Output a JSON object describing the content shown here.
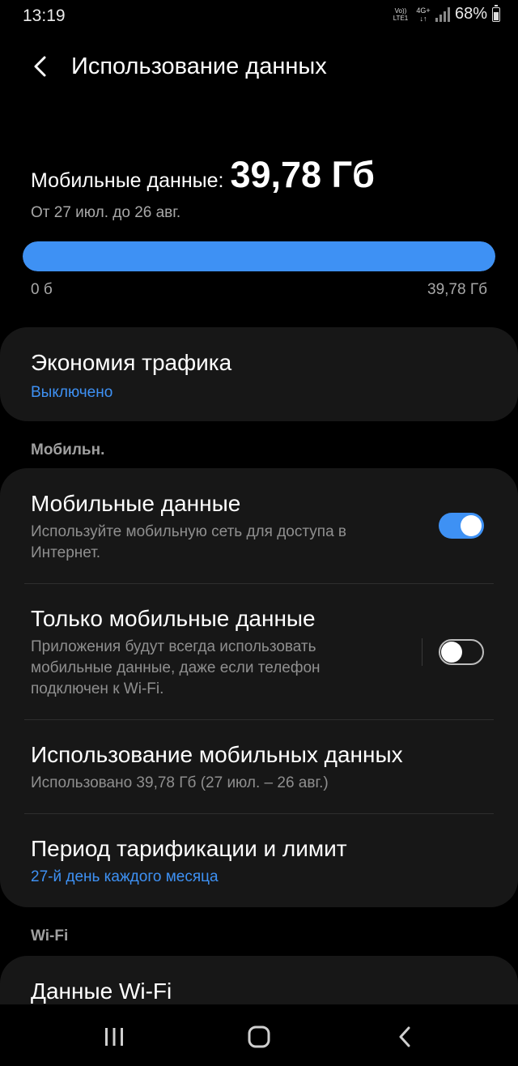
{
  "status_bar": {
    "time": "13:19",
    "volte_top": "Vo))",
    "volte_bottom": "LTE1",
    "network_top": "4G+",
    "network_bottom": "↓↑",
    "battery": "68%"
  },
  "header": {
    "back_icon": "chevron-left-icon",
    "title": "Использование данных"
  },
  "usage": {
    "label": "Мобильные данные:",
    "value": "39,78 Гб",
    "range": "От 27 июл. до 26 авг.",
    "progress_fraction": 1.0,
    "min_label": "0 б",
    "max_label": "39,78 Гб",
    "accent_color": "#3e91f4"
  },
  "data_saver": {
    "title": "Экономия трафика",
    "status": "Выключено"
  },
  "mobile_section": {
    "label": "Мобильн.",
    "items": [
      {
        "title": "Мобильные данные",
        "subtitle": "Используйте мобильную сеть для доступа в Интернет.",
        "toggle": "on"
      },
      {
        "title": "Только мобильные данные",
        "subtitle": "Приложения будут всегда использовать мобильные данные, даже если телефон подключен к Wi-Fi.",
        "toggle": "off"
      },
      {
        "title": "Использование мобильных данных",
        "subtitle": "Использовано 39,78 Гб (27 июл. – 26 авг.)"
      },
      {
        "title": "Период тарификации и лимит",
        "subtitle": "27-й день каждого месяца"
      }
    ]
  },
  "wifi_section": {
    "label": "Wi-Fi",
    "items": [
      {
        "title": "Данные Wi-Fi"
      }
    ]
  },
  "nav_bar": {
    "recents_icon": "recents-icon",
    "home_icon": "home-icon",
    "back_icon": "back-icon"
  }
}
